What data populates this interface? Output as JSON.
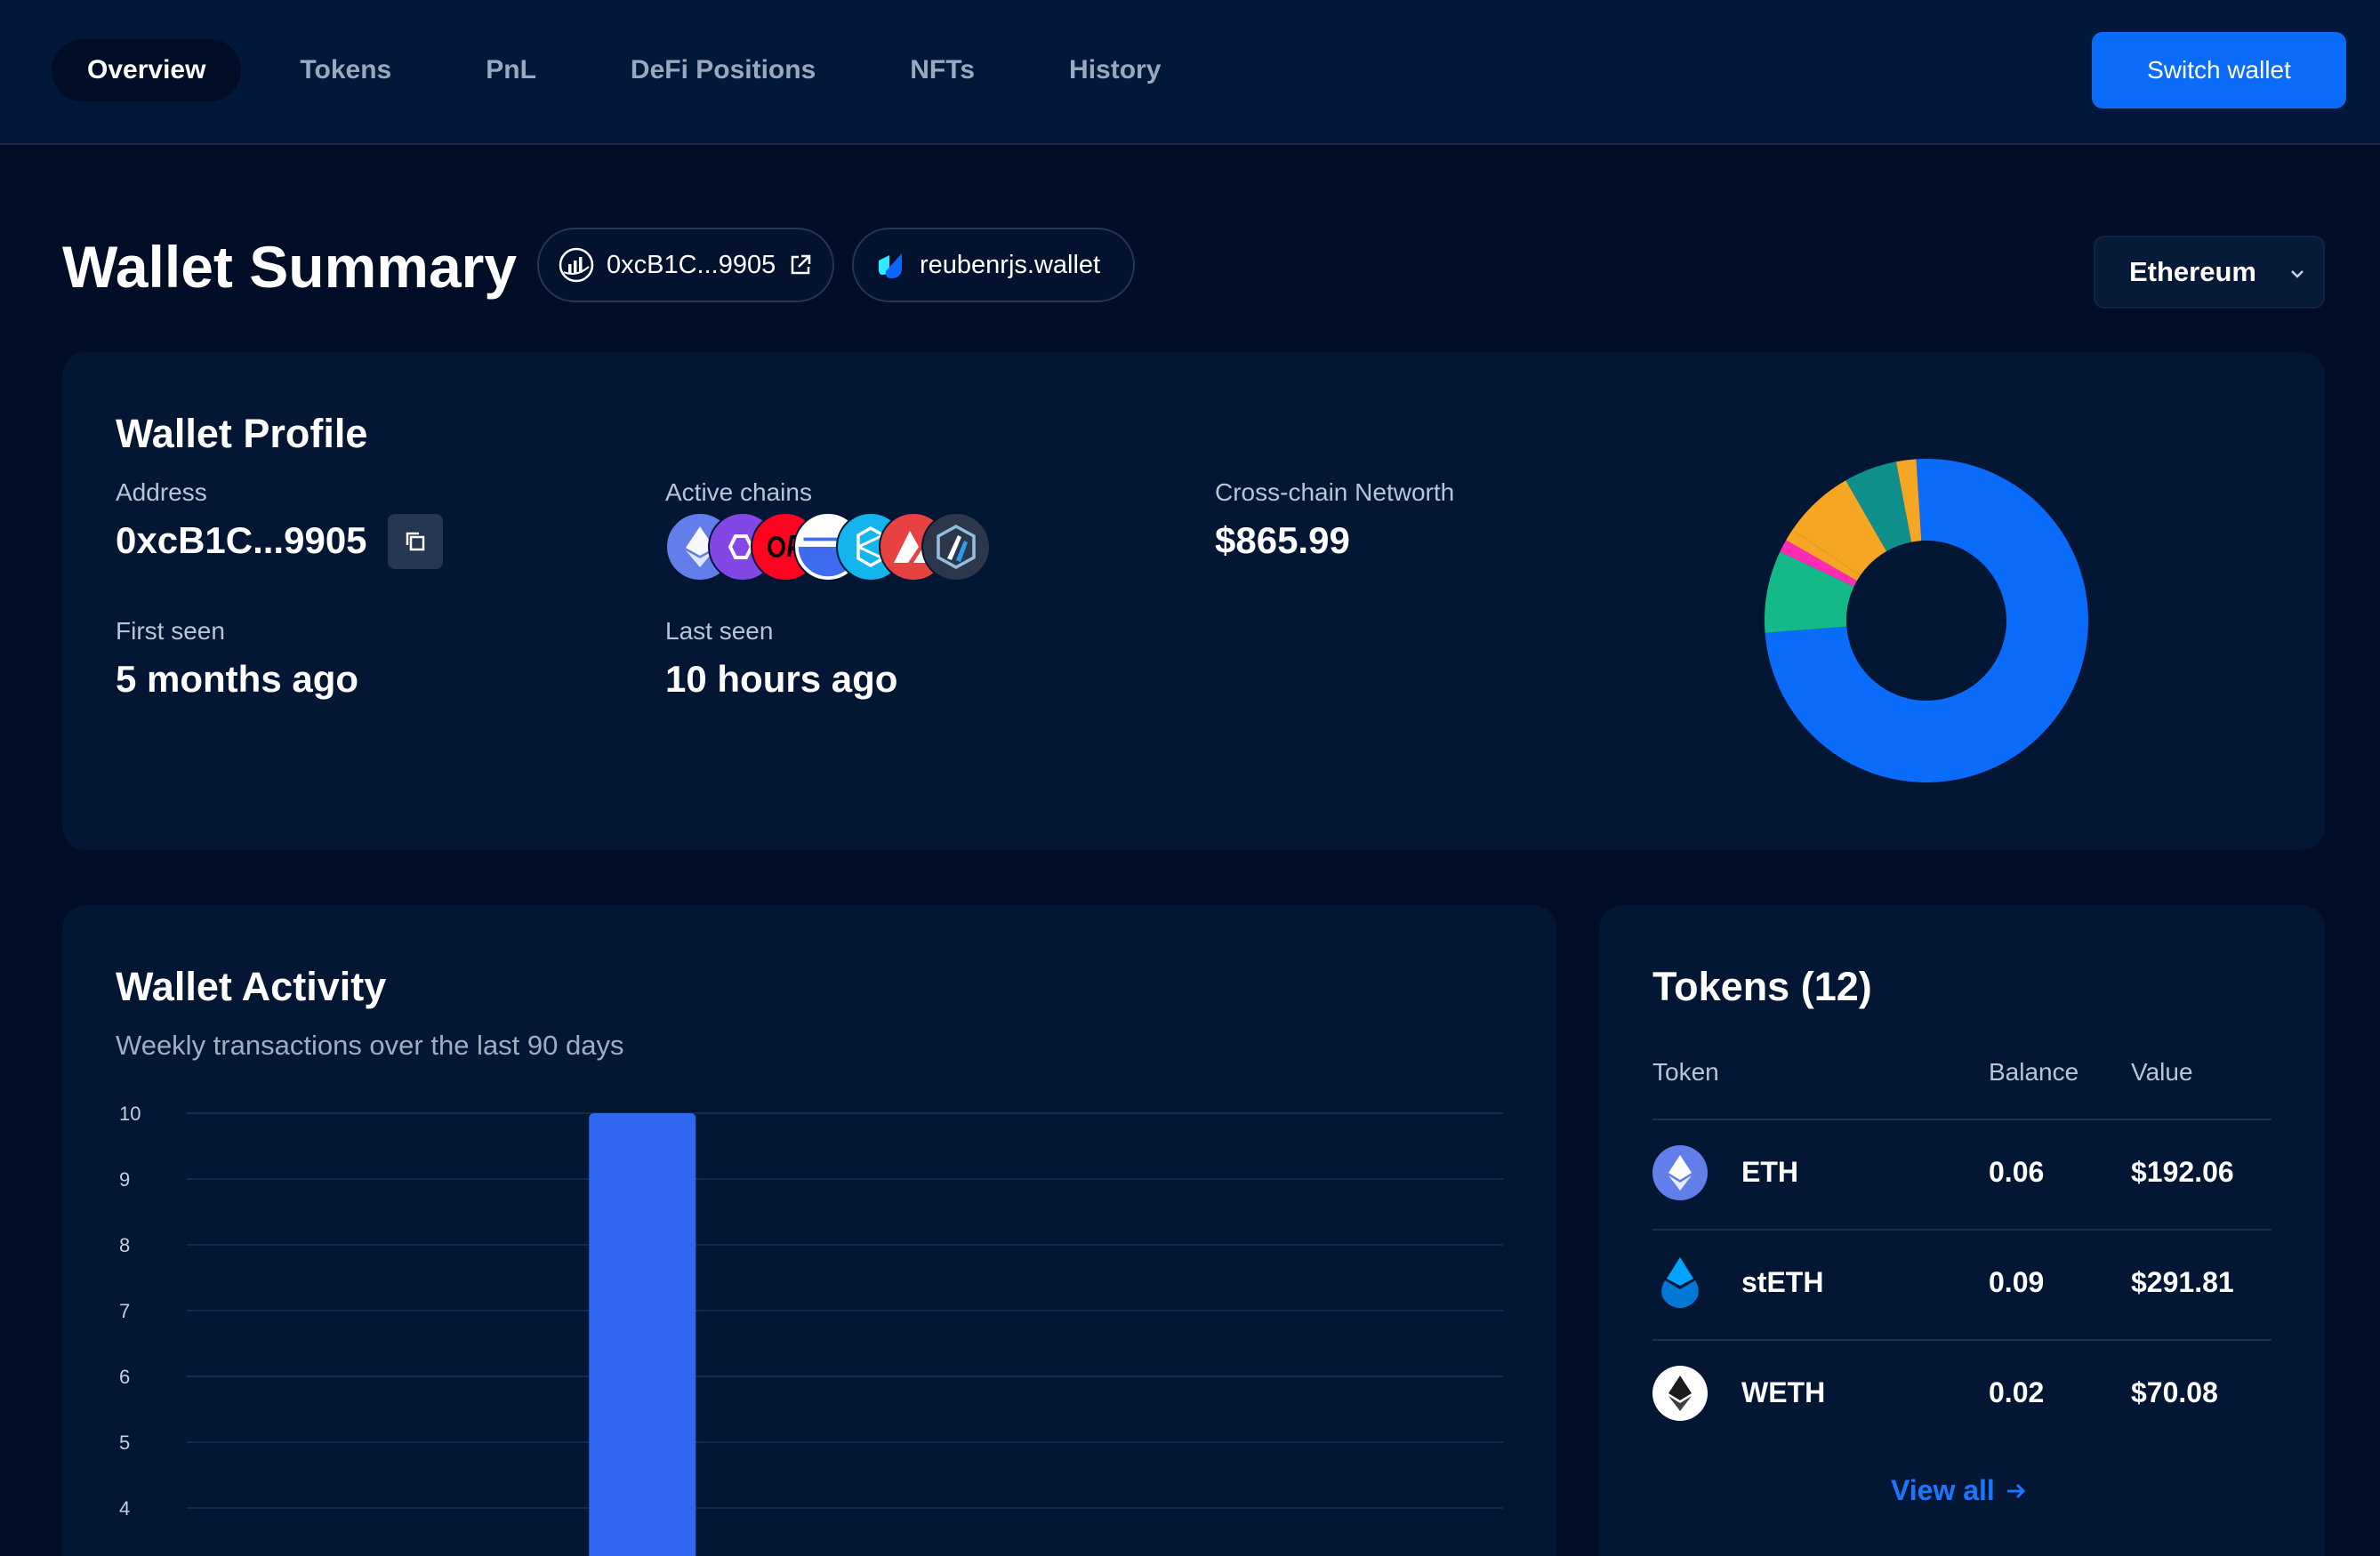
{
  "nav": {
    "tabs": [
      {
        "label": "Overview",
        "active": true
      },
      {
        "label": "Tokens",
        "active": false
      },
      {
        "label": "PnL",
        "active": false
      },
      {
        "label": "DeFi Positions",
        "active": false
      },
      {
        "label": "NFTs",
        "active": false
      },
      {
        "label": "History",
        "active": false
      }
    ],
    "switch_wallet": "Switch wallet"
  },
  "header": {
    "title": "Wallet Summary",
    "address_pill": "0xcB1C...9905",
    "ens_pill": "reubenrjs.wallet",
    "chain_select": "Ethereum"
  },
  "profile": {
    "title": "Wallet Profile",
    "address_label": "Address",
    "address_value": "0xcB1C...9905",
    "chains_label": "Active chains",
    "active_chains": [
      {
        "icon": "ethereum-icon",
        "color": "#627eea"
      },
      {
        "icon": "polygon-icon",
        "color": "#8247e5"
      },
      {
        "icon": "optimism-icon",
        "color": "#ff0420"
      },
      {
        "icon": "gnosis-icon",
        "color": "#ffffff"
      },
      {
        "icon": "fantom-icon",
        "color": "#13b5ec"
      },
      {
        "icon": "avalanche-icon",
        "color": "#e84142"
      },
      {
        "icon": "arbitrum-icon",
        "color": "#2d374b"
      }
    ],
    "networth_label": "Cross-chain Networth",
    "networth_value": "$865.99",
    "first_seen_label": "First seen",
    "first_seen_value": "5 months ago",
    "last_seen_label": "Last seen",
    "last_seen_value": "10 hours ago",
    "donut": [
      {
        "share": 0.738,
        "color": "#0b6bfa"
      },
      {
        "share": 0.082,
        "color": "#14b98a"
      },
      {
        "share": 0.013,
        "color": "#ff2bb5"
      },
      {
        "share": 0.012,
        "color": "#f5a623"
      },
      {
        "share": 0.072,
        "color": "#f5a623"
      },
      {
        "share": 0.053,
        "color": "#0e8f8c"
      },
      {
        "share": 0.02,
        "color": "#f5a623"
      },
      {
        "share": 0.01,
        "color": "#0b6bfa"
      }
    ]
  },
  "activity": {
    "title": "Wallet Activity",
    "subtitle": "Weekly transactions over the last 90 days"
  },
  "chart_data": {
    "type": "bar",
    "y_ticks": [
      "4",
      "5",
      "6",
      "7",
      "8",
      "9",
      "10"
    ],
    "ylim": [
      4,
      10
    ],
    "bar_color": "#3168f2",
    "series": [
      {
        "values": [
          0,
          0,
          0,
          0,
          10,
          0,
          0,
          0,
          0,
          0,
          0,
          0,
          0
        ]
      }
    ]
  },
  "tokens": {
    "title": "Tokens (12)",
    "col_token": "Token",
    "col_balance": "Balance",
    "col_value": "Value",
    "rows": [
      {
        "symbol": "ETH",
        "balance": "0.06",
        "value": "$192.06",
        "icon": "eth-icon"
      },
      {
        "symbol": "stETH",
        "balance": "0.09",
        "value": "$291.81",
        "icon": "steth-icon"
      },
      {
        "symbol": "WETH",
        "balance": "0.02",
        "value": "$70.08",
        "icon": "weth-icon"
      }
    ],
    "view_all": "View all"
  }
}
